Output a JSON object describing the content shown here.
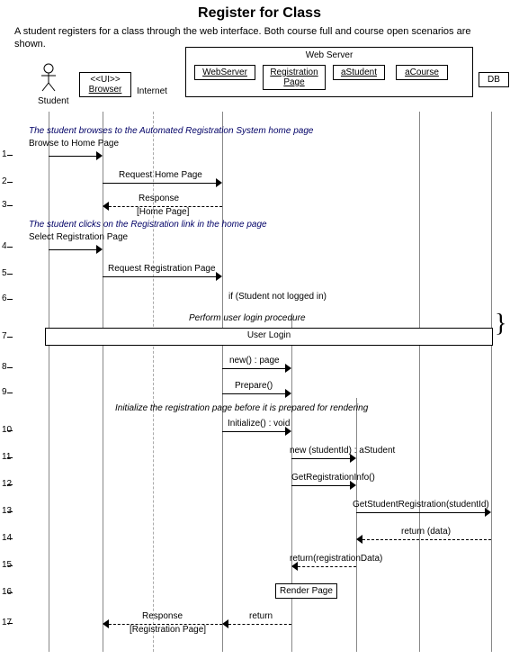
{
  "title": "Register for Class",
  "description": "A student registers for a class through the web interface. Both course full and course open scenarios are shown.",
  "container": "Web Server",
  "lifelines": {
    "student": "Student",
    "browser_stereo": "<<UI>>",
    "browser": "Browser",
    "internet": "Internet",
    "webserver": "WebServer",
    "regpage": "Registration Page",
    "astudent": "aStudent",
    "acourse": "aCourse",
    "db": "DB"
  },
  "comments": {
    "c1": "The student browses to the Automated Registration System home page",
    "c2": "The student clicks on the Registration link in the home page",
    "c3": "Perform user login procedure",
    "c4": "Initialize the registration page before it is prepared for rendering"
  },
  "refbox": "User Login",
  "cond": "if (Student not logged in)",
  "render": "Render Page",
  "msgs": {
    "m1": "Browse to Home Page",
    "m2": "Request Home Page",
    "m3": "Response",
    "m3b": "[Home Page]",
    "m4": "Select Registration Page",
    "m5": "Request Registration Page",
    "m8": "new() : page",
    "m9": "Prepare()",
    "m10": "Initialize() : void",
    "m11": "new (studentId) : aStudent",
    "m12": "GetRegistrationInfo()",
    "m13": "GetStudentRegistration(studentId)",
    "m14": "return (data)",
    "m15": "return(registrationData)",
    "m17a": "Response",
    "m17b": "return",
    "m17c": "[Registration Page]"
  },
  "rows": [
    "1",
    "2",
    "3",
    "4",
    "5",
    "6",
    "7",
    "8",
    "9",
    "10",
    "11",
    "12",
    "13",
    "14",
    "15",
    "16",
    "17"
  ]
}
